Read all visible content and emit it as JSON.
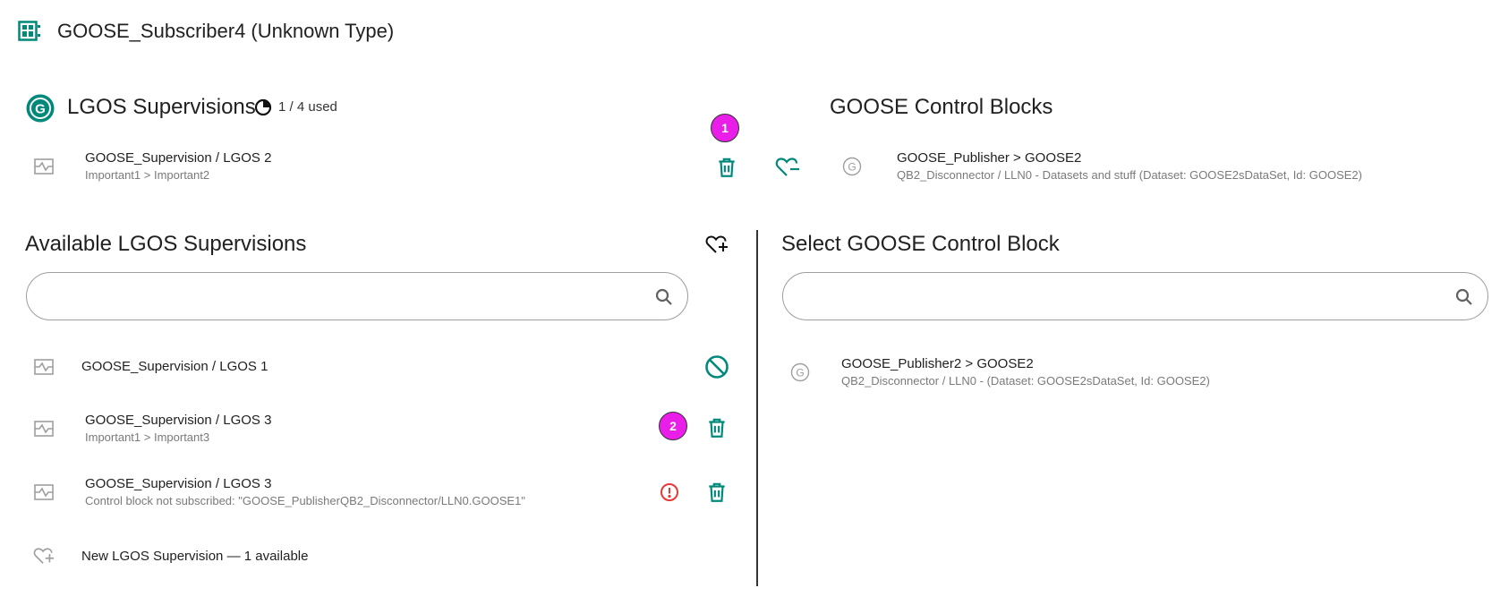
{
  "header": {
    "title": "GOOSE_Subscriber4 (Unknown Type)"
  },
  "lgos": {
    "title": "LGOS Supervisions",
    "usage": "1 / 4 used",
    "item": {
      "primary": "GOOSE_Supervision / LGOS 2",
      "secondary": "Important1 > Important2"
    }
  },
  "badges": {
    "one": "1",
    "two": "2"
  },
  "gcb": {
    "title": "GOOSE Control Blocks",
    "item": {
      "primary": "GOOSE_Publisher > GOOSE2",
      "secondary": "QB2_Disconnector / LLN0 - Datasets and stuff (Dataset: GOOSE2sDataSet, Id: GOOSE2)"
    }
  },
  "available": {
    "title": "Available LGOS Supervisions",
    "search_placeholder": "",
    "items": [
      {
        "primary": "GOOSE_Supervision / LGOS 1",
        "secondary": ""
      },
      {
        "primary": "GOOSE_Supervision / LGOS 3",
        "secondary": "Important1 > Important3"
      },
      {
        "primary": "GOOSE_Supervision / LGOS 3",
        "secondary": "Control block not subscribed: \"GOOSE_PublisherQB2_Disconnector/LLN0.GOOSE1\""
      }
    ],
    "new_item": "New LGOS Supervision — 1 available"
  },
  "select_gcb": {
    "title": "Select GOOSE Control Block",
    "search_placeholder": "",
    "item": {
      "primary": "GOOSE_Publisher2 > GOOSE2",
      "secondary": "QB2_Disconnector / LLN0 - (Dataset: GOOSE2sDataSet, Id: GOOSE2)"
    }
  },
  "colors": {
    "accent": "#00897b",
    "error": "#e53935",
    "badge": "#e91ee9"
  },
  "icons": [
    "ied-icon",
    "goose-badge-icon",
    "pie-chart-icon",
    "supervision-icon",
    "delete-icon",
    "heart-minus-icon",
    "goose-icon",
    "heart-plus-icon",
    "search-icon",
    "block-icon",
    "error-icon"
  ]
}
